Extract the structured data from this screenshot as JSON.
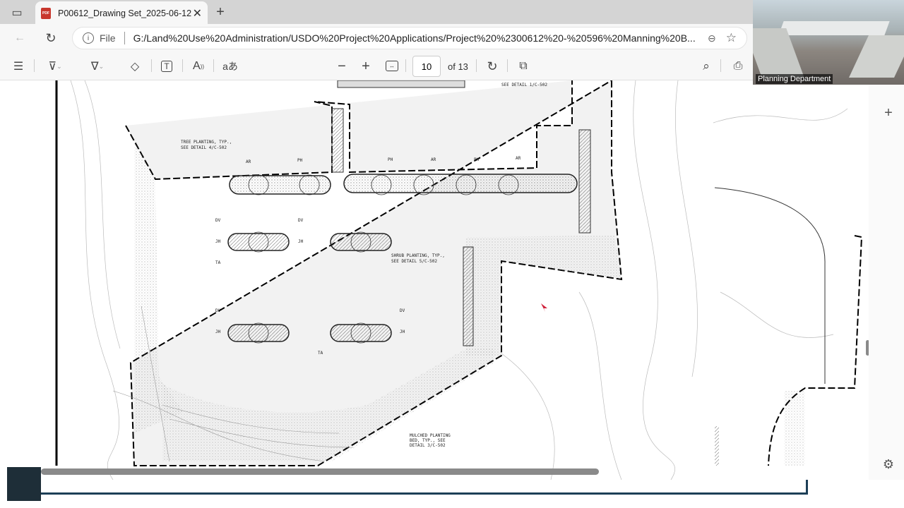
{
  "browser": {
    "tab_title": "P00612_Drawing Set_2025-06-12",
    "tab_icon": "pdf-icon",
    "url_scheme_label": "File",
    "url": "G:/Land%20Use%20Administration/USDO%20Project%20Applications/Project%20%2300612%20-%20596%20Manning%20B..."
  },
  "pdf_toolbar": {
    "page_current": "10",
    "page_total": "of 13",
    "read_aloud_label": "aあ"
  },
  "video": {
    "label": "Planning Department"
  },
  "drawing": {
    "annotations": {
      "tree": [
        "TREE PLANTING, TYP.,",
        "SEE DETAIL 4/C-502"
      ],
      "shrub": [
        "SHRUB PLANTING, TYP.,",
        "SEE DETAIL 5/C-502"
      ],
      "mulch": [
        "MULCHED PLANTING",
        "BED, TYP., SEE",
        "DETAIL 3/C-502"
      ],
      "top": "SEE DETAIL 1/C-502"
    },
    "tags": [
      "AR",
      "PH",
      "PH",
      "AR",
      "PH",
      "AR",
      "DV",
      "DV",
      "DV",
      "DV",
      "JH",
      "JH",
      "JH",
      "JH",
      "TA",
      "TA"
    ]
  },
  "colors": {
    "accent_line": "#1d3f57",
    "cursor": "#d0203a"
  }
}
